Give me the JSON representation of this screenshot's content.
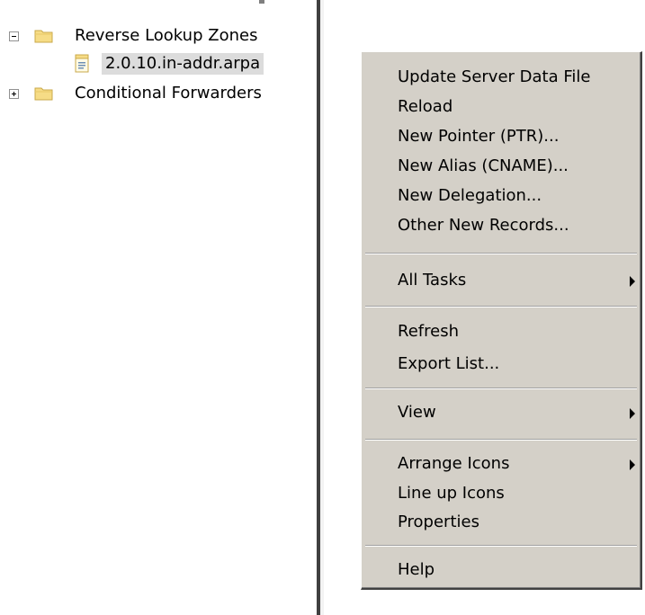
{
  "tree": {
    "items": [
      {
        "label": "Reverse Lookup Zones",
        "expander": "minus",
        "icon": "folder-icon"
      },
      {
        "label": "2.0.10.in-addr.arpa",
        "icon": "zone-file-icon",
        "selected": true
      },
      {
        "label": "Conditional Forwarders",
        "expander": "plus",
        "icon": "folder-icon"
      }
    ]
  },
  "context_menu": {
    "groups": [
      {
        "items": [
          {
            "label": "Update Server Data File"
          },
          {
            "label": "Reload"
          },
          {
            "label": "New Pointer (PTR)..."
          },
          {
            "label": "New Alias (CNAME)..."
          },
          {
            "label": "New Delegation..."
          },
          {
            "label": "Other New Records..."
          }
        ]
      },
      {
        "items": [
          {
            "label": "All Tasks",
            "submenu": true
          }
        ]
      },
      {
        "items": [
          {
            "label": "Refresh"
          },
          {
            "label": "Export List..."
          }
        ]
      },
      {
        "items": [
          {
            "label": "View",
            "submenu": true
          }
        ]
      },
      {
        "items": [
          {
            "label": "Arrange Icons",
            "submenu": true
          },
          {
            "label": "Line up Icons"
          },
          {
            "label": "Properties"
          }
        ]
      },
      {
        "items": [
          {
            "label": "Help"
          }
        ]
      }
    ]
  },
  "colors": {
    "menu_background": "#d4d0c8",
    "selection_background": "#dcdcdc",
    "folder_yellow": "#f5d77a"
  }
}
